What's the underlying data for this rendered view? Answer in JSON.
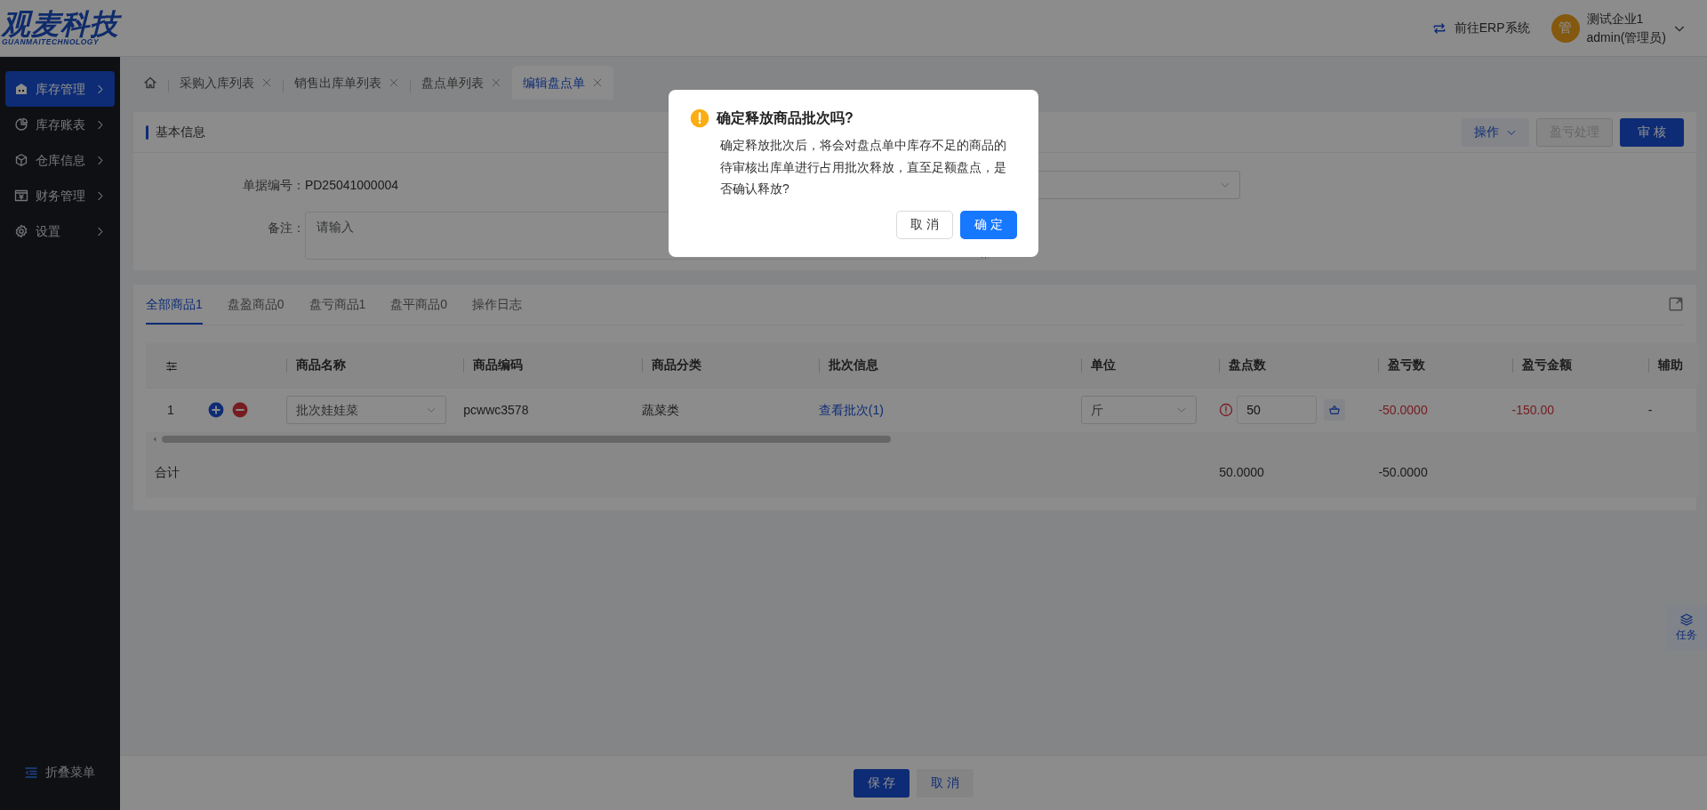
{
  "header": {
    "logo": "观麦科技",
    "logo_sub": "GUANMAITECHNOLOGY",
    "erp_link": "前往ERP系统",
    "avatar": "管",
    "company": "测试企业1",
    "user": "admin(管理员)"
  },
  "sidebar": {
    "items": [
      {
        "label": "库存管理",
        "kind": "warehouse",
        "selected": true
      },
      {
        "label": "库存账表",
        "kind": "chart",
        "selected": false
      },
      {
        "label": "仓库信息",
        "kind": "box",
        "selected": false
      },
      {
        "label": "财务管理",
        "kind": "finance",
        "selected": false
      },
      {
        "label": "设置",
        "kind": "gear",
        "selected": false
      }
    ],
    "collapse": "折叠菜单"
  },
  "page_tabs": [
    {
      "kind": "home",
      "selected": false
    },
    {
      "kind": "text",
      "label": "采购入库列表",
      "selected": false
    },
    {
      "kind": "text",
      "label": "销售出库单列表",
      "selected": false
    },
    {
      "kind": "text",
      "label": "盘点单列表",
      "selected": false
    },
    {
      "kind": "text",
      "label": "编辑盘点单",
      "selected": true
    }
  ],
  "basic_info": {
    "title": "基本信息",
    "actions": [
      {
        "label": "操作",
        "kind": "dropdown",
        "disabled": false
      },
      {
        "label": "盈亏处理",
        "kind": "outline",
        "disabled": true
      },
      {
        "label": "审 核",
        "kind": "primary",
        "disabled": false
      }
    ],
    "number_label": "单据编号：",
    "number": "PD25041000004",
    "note_label": "备注：",
    "note_placeholder": "请输入"
  },
  "detail_tabs": [
    {
      "label": "全部商品1",
      "selected": true
    },
    {
      "label": "盘盈商品0",
      "selected": false
    },
    {
      "label": "盘亏商品1",
      "selected": false
    },
    {
      "label": "盘平商品0",
      "selected": false
    },
    {
      "label": "操作日志",
      "selected": false
    }
  ],
  "table": {
    "columns": [
      "商品名称",
      "商品编码",
      "商品分类",
      "批次信息",
      "单位",
      "盘点数",
      "盈亏数",
      "盈亏金额",
      "辅助"
    ],
    "rows": [
      {
        "index": "1",
        "name": "批次娃娃菜",
        "code": "pcwwc3578",
        "category": "蔬菜类",
        "batch": "查看批次(1)",
        "unit": "斤",
        "count": "50",
        "warning": true,
        "diff": "-50.0000",
        "amount": "-150.00",
        "loss": true,
        "aux": "-"
      }
    ],
    "totals": {
      "label": "合计",
      "count": "50.0000",
      "diff": "-50.0000"
    }
  },
  "footer": {
    "save": "保 存",
    "cancel": "取 消"
  },
  "task_button": "任务",
  "dialog": {
    "title": "确定释放商品批次吗?",
    "message": "确定释放批次后，将会对盘点单中库存不足的商品的待审核出库单进行占用批次释放，直至足额盘点，是否确认释放?",
    "cancel": "取 消",
    "confirm": "确 定"
  }
}
